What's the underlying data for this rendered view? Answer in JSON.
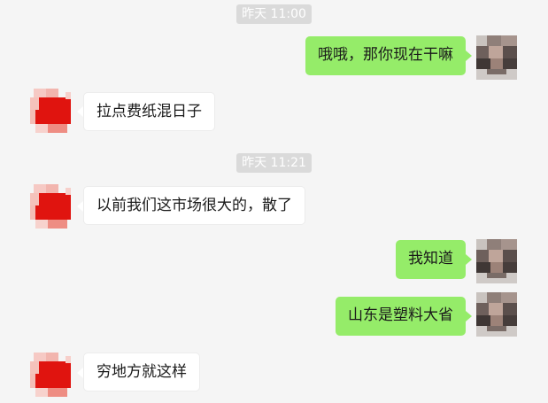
{
  "timestamps": [
    "昨天 11:00",
    "昨天 11:21"
  ],
  "messages": [
    {
      "side": "right",
      "text": "哦哦，那你现在干嘛",
      "avatar_icon": "user-photo-avatar"
    },
    {
      "side": "left",
      "text": "拉点费纸混日子",
      "avatar_icon": "red-avatar"
    },
    {
      "side": "left",
      "text": "以前我们这市场很大的，散了",
      "avatar_icon": "red-avatar"
    },
    {
      "side": "right",
      "text": "我知道",
      "avatar_icon": "user-photo-avatar"
    },
    {
      "side": "right",
      "text": "山东是塑料大省",
      "avatar_icon": "user-photo-avatar"
    },
    {
      "side": "left",
      "text": "穷地方就这样",
      "avatar_icon": "red-avatar"
    }
  ],
  "colors": {
    "background": "#f5f5f5",
    "sent_bubble": "#95ec69",
    "received_bubble": "#ffffff",
    "timestamp_bg": "#dadada",
    "timestamp_text": "#ffffff",
    "red_avatar": "#e0140f"
  }
}
